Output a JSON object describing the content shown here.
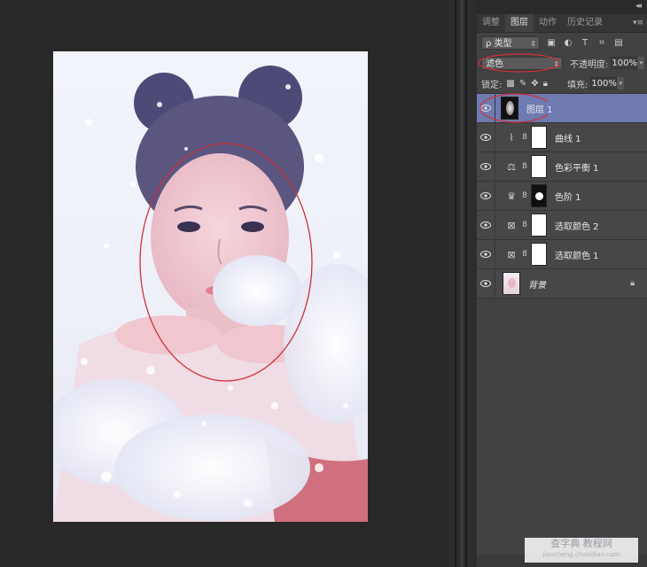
{
  "panel": {
    "collapse_glyph": "◂◂",
    "menu_glyph": "▾≡",
    "tabs": [
      {
        "label": "调整",
        "active": false
      },
      {
        "label": "图层",
        "active": true
      },
      {
        "label": "动作",
        "active": false
      },
      {
        "label": "历史记录",
        "active": false
      }
    ],
    "filter": {
      "label": "ρ 类型",
      "arrow": "⇕"
    },
    "blend_mode": {
      "value": "滤色",
      "arrow": "⇕"
    },
    "opacity": {
      "label": "不透明度:",
      "value": "100%"
    },
    "lock": {
      "label": "锁定:"
    },
    "fill": {
      "label": "填充:",
      "value": "100%"
    },
    "layers": [
      {
        "name": "图层 1",
        "type": "pixel",
        "selected": true
      },
      {
        "name": "曲线 1",
        "type": "curves",
        "selected": false
      },
      {
        "name": "色彩平衡 1",
        "type": "color-balance",
        "selected": false
      },
      {
        "name": "色阶 1",
        "type": "levels",
        "selected": false
      },
      {
        "name": "选取颜色 2",
        "type": "selective-color",
        "selected": false
      },
      {
        "name": "选取颜色 1",
        "type": "selective-color",
        "selected": false
      },
      {
        "name": "背景",
        "type": "background",
        "selected": false
      }
    ]
  },
  "watermark": {
    "main": "查字典 教程网",
    "sub": "jiaocheng.chazidian.com"
  },
  "colors": {
    "selected_layer": "#6e7ab1",
    "panel_bg": "#424242",
    "annotation": "#d0303a"
  }
}
